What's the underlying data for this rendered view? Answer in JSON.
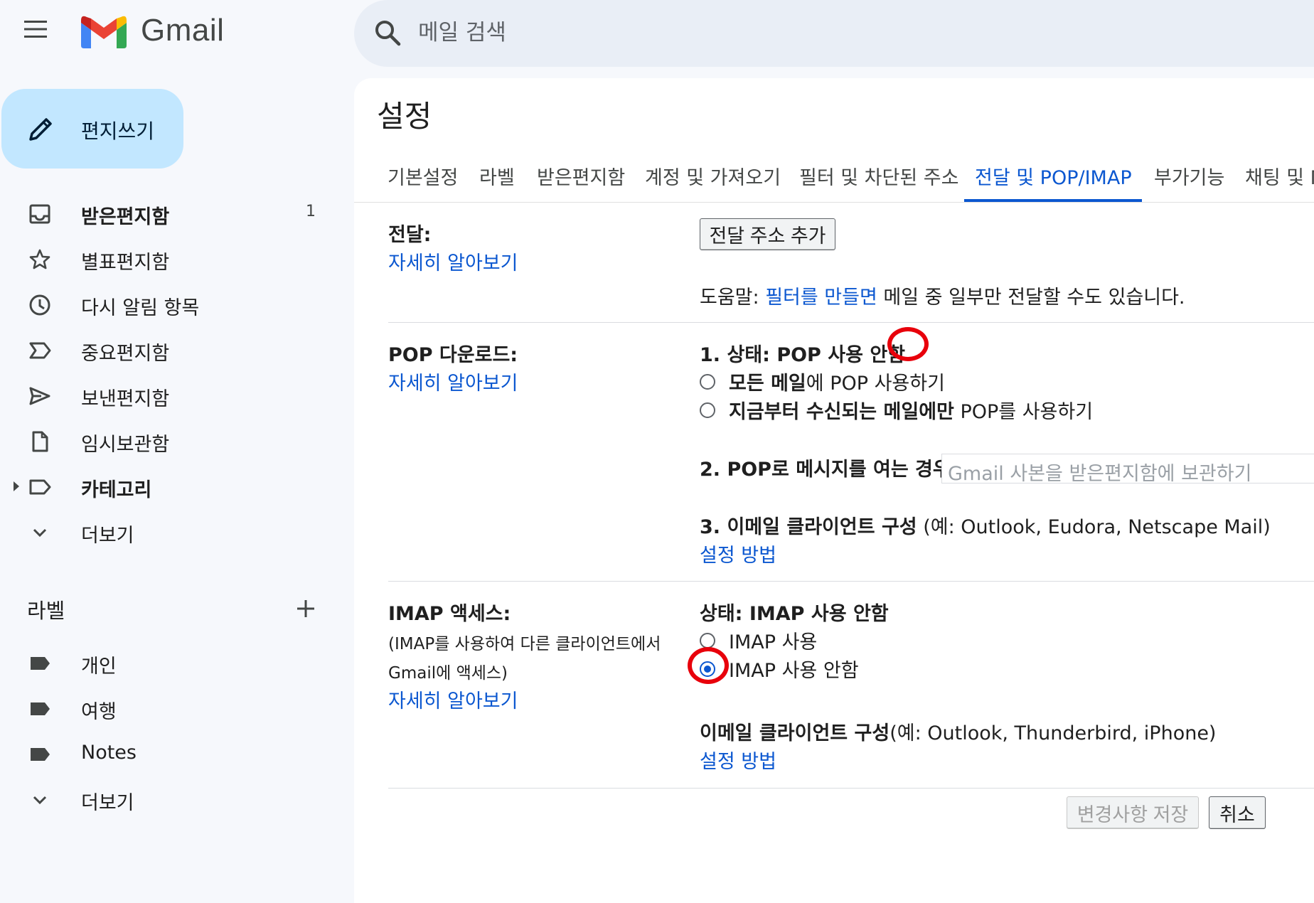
{
  "app": {
    "name": "Gmail",
    "search_placeholder": "메일 검색"
  },
  "compose": {
    "label": "편지쓰기"
  },
  "sidebar": {
    "items": [
      {
        "label": "받은편지함",
        "count": "1",
        "icon": "inbox-icon",
        "bold": true
      },
      {
        "label": "별표편지함",
        "icon": "star-icon"
      },
      {
        "label": "다시 알림 항목",
        "icon": "clock-icon"
      },
      {
        "label": "중요편지함",
        "icon": "important-icon"
      },
      {
        "label": "보낸편지함",
        "icon": "send-icon"
      },
      {
        "label": "임시보관함",
        "icon": "draft-icon"
      },
      {
        "label": "카테고리",
        "icon": "label-outline-icon",
        "bold": true
      },
      {
        "label": "더보기",
        "icon": "chevron-down-icon"
      }
    ],
    "labels_heading": "라벨",
    "labels": [
      {
        "label": "개인",
        "icon": "label-icon"
      },
      {
        "label": "여행",
        "icon": "label-icon"
      },
      {
        "label": "Notes",
        "icon": "label-icon"
      },
      {
        "label": "더보기",
        "icon": "chevron-down-icon"
      }
    ]
  },
  "settings": {
    "title": "설정",
    "tabs": [
      "기본설정",
      "라벨",
      "받은편지함",
      "계정 및 가져오기",
      "필터 및 차단된 주소",
      "전달 및 POP/IMAP",
      "부가기능",
      "채팅 및 M"
    ],
    "active_tab": "전달 및 POP/IMAP",
    "forwarding": {
      "title": "전달:",
      "learn_more": "자세히 알아보기",
      "add_button": "전달 주소 추가",
      "tip_prefix": "도움말: ",
      "tip_link": "필터를 만들면",
      "tip_suffix": " 메일 중 일부만 전달할 수도 있습니다."
    },
    "pop": {
      "title": "POP 다운로드:",
      "learn_more": "자세히 알아보기",
      "status": "1. 상태: POP 사용 안함",
      "option1_bold": "모든 메일",
      "option1_rest": "에 POP 사용하기",
      "option2_bold": "지금부터 수신되는 메일에만",
      "option2_rest": " POP를 사용하기",
      "step2_label": "2. POP로 메시지를 여는 경우",
      "step2_select": "Gmail 사본을 받은편지함에 보관하기",
      "step3_bold": "3. 이메일 클라이언트 구성",
      "step3_rest": " (예: Outlook, Eudora, Netscape Mail)",
      "setup_link": "설정 방법"
    },
    "imap": {
      "title": "IMAP 액세스:",
      "desc_line1": "(IMAP를 사용하여 다른 클라이언트에서",
      "desc_line2": "Gmail에 액세스)",
      "learn_more": "자세히 알아보기",
      "status": "상태: IMAP 사용 안함",
      "option_enable": "IMAP 사용",
      "option_disable": "IMAP 사용 안함",
      "selected": "IMAP 사용 안함",
      "client_bold": "이메일 클라이언트 구성",
      "client_rest": "(예: Outlook, Thunderbird, iPhone)",
      "setup_link": "설정 방법"
    },
    "footer": {
      "save_button": "변경사항 저장",
      "cancel_button": "취소"
    }
  },
  "colors": {
    "accent": "#0b57d0",
    "compose_bg": "#c2e7ff",
    "annotation": "#e8000b"
  }
}
